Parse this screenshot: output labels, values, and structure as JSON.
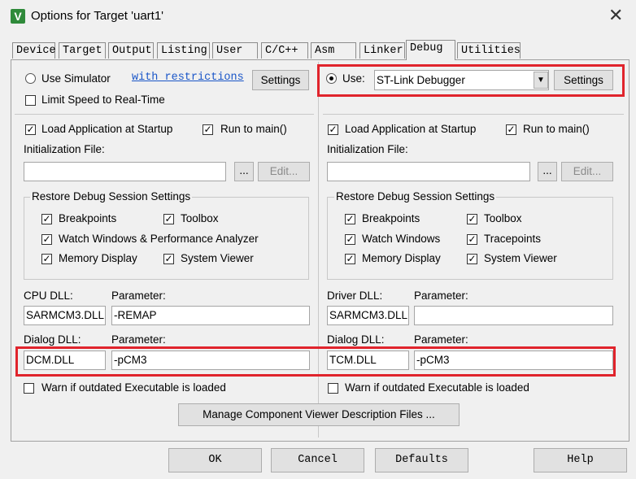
{
  "window": {
    "title": "Options for Target 'uart1'"
  },
  "tabs": [
    "Device",
    "Target",
    "Output",
    "Listing",
    "User",
    "C/C++",
    "Asm",
    "Linker",
    "Debug",
    "Utilities"
  ],
  "left": {
    "use_simulator": "Use Simulator",
    "restrictions_link": "with restrictions",
    "settings": "Settings",
    "limit_speed": "Limit Speed to Real-Time",
    "load_app": "Load Application at Startup",
    "run_to_main": "Run to main()",
    "init_file_label": "Initialization File:",
    "browse": "...",
    "edit": "Edit...",
    "restore_group": "Restore Debug Session Settings",
    "breakpoints": "Breakpoints",
    "toolbox": "Toolbox",
    "watch_windows": "Watch Windows & Performance Analyzer",
    "memory_display": "Memory Display",
    "system_viewer": "System Viewer",
    "dll_label": "CPU DLL:",
    "param_label": "Parameter:",
    "dll_value": "SARMCM3.DLL",
    "dll_param": "-REMAP",
    "dialog_dll_label": "Dialog DLL:",
    "dialog_param_label": "Parameter:",
    "dialog_dll_value": "DCM.DLL",
    "dialog_param": "-pCM3",
    "warn": "Warn if outdated Executable is loaded"
  },
  "right": {
    "use": "Use:",
    "debugger": "ST-Link Debugger",
    "settings": "Settings",
    "load_app": "Load Application at Startup",
    "run_to_main": "Run to main()",
    "init_file_label": "Initialization File:",
    "browse": "...",
    "edit": "Edit...",
    "restore_group": "Restore Debug Session Settings",
    "breakpoints": "Breakpoints",
    "toolbox": "Toolbox",
    "watch_windows": "Watch Windows",
    "tracepoints": "Tracepoints",
    "memory_display": "Memory Display",
    "system_viewer": "System Viewer",
    "dll_label": "Driver DLL:",
    "param_label": "Parameter:",
    "dll_value": "SARMCM3.DLL",
    "dll_param": "",
    "dialog_dll_label": "Dialog DLL:",
    "dialog_param_label": "Parameter:",
    "dialog_dll_value": "TCM.DLL",
    "dialog_param": "-pCM3",
    "warn": "Warn if outdated Executable is loaded"
  },
  "manage_button": "Manage Component Viewer Description Files ...",
  "footer": {
    "ok": "OK",
    "cancel": "Cancel",
    "defaults": "Defaults",
    "help": "Help"
  },
  "colors": {
    "highlight": "#e0242c",
    "link": "#1a56c8"
  }
}
